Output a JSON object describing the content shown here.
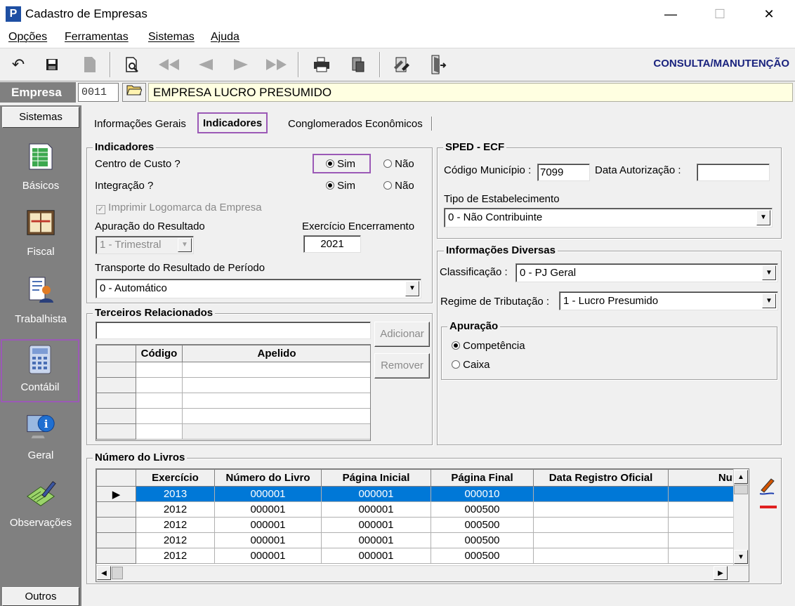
{
  "window": {
    "title": "Cadastro de Empresas",
    "app_icon": "P",
    "minimize": "—",
    "maximize": "☐",
    "close": "✕"
  },
  "menu": {
    "items": [
      "Opções",
      "Ferramentas",
      "Sistemas",
      "Ajuda"
    ]
  },
  "toolbar": {
    "mode_label": "CONSULTA/MANUTENÇÃO"
  },
  "empresa": {
    "label": "Empresa",
    "code": "0011",
    "name": "EMPRESA LUCRO PRESUMIDO"
  },
  "sidebar": {
    "header": "Sistemas",
    "footer": "Outros",
    "items": [
      {
        "label": "Básicos",
        "icon": "spreadsheet-icon"
      },
      {
        "label": "Fiscal",
        "icon": "ledger-book-icon"
      },
      {
        "label": "Trabalhista",
        "icon": "worker-document-icon"
      },
      {
        "label": "Contábil",
        "icon": "calculator-icon"
      },
      {
        "label": "Geral",
        "icon": "info-monitor-icon"
      },
      {
        "label": "Observações",
        "icon": "notes-pencil-icon"
      }
    ]
  },
  "tabs": [
    "Informações Gerais",
    "Indicadores",
    "Conglomerados Econômicos"
  ],
  "indicadores": {
    "title": "Indicadores",
    "centro_custo": {
      "label": "Centro de Custo ?",
      "sim": "Sim",
      "nao": "Não",
      "value": "Sim"
    },
    "integracao": {
      "label": "Integração ?",
      "sim": "Sim",
      "nao": "Não",
      "value": "Sim"
    },
    "logomarca": {
      "label": "Imprimir Logomarca da Empresa",
      "checked": true
    },
    "apuracao_resultado": {
      "label": "Apuração do Resultado",
      "value": "1 - Trimestral"
    },
    "exercicio_encerramento": {
      "label": "Exercício Encerramento",
      "value": "2021"
    },
    "transporte": {
      "label": "Transporte do Resultado de Período",
      "value": "0 - Automático"
    }
  },
  "terceiros": {
    "title": "Terceiros Relacionados",
    "add_label": "Adicionar",
    "remove_label": "Remover",
    "columns": [
      "Código",
      "Apelido"
    ]
  },
  "sped": {
    "title": "SPED - ECF",
    "codigo_municipio": {
      "label": "Código Município :",
      "value": "7099"
    },
    "data_autorizacao": {
      "label": "Data Autorização :",
      "value": ""
    },
    "tipo_estabelecimento": {
      "label": "Tipo de Estabelecimento",
      "value": "0 - Não Contribuinte"
    }
  },
  "diversas": {
    "title": "Informações Diversas",
    "classificacao": {
      "label": "Classificação :",
      "value": "0 - PJ Geral"
    },
    "regime": {
      "label": "Regime de Tributação :",
      "value": "1 - Lucro Presumido"
    },
    "apuracao": {
      "title": "Apuração",
      "competencia": "Competência",
      "caixa": "Caixa",
      "value": "Competência"
    }
  },
  "livros": {
    "title": "Número do Livros",
    "columns": [
      "Exercício",
      "Número do Livro",
      "Página Inicial",
      "Página Final",
      "Data Registro Oficial",
      "Nun"
    ],
    "rows": [
      [
        "2013",
        "000001",
        "000001",
        "000010",
        ""
      ],
      [
        "2012",
        "000001",
        "000001",
        "000500",
        ""
      ],
      [
        "2012",
        "000001",
        "000001",
        "000500",
        ""
      ],
      [
        "2012",
        "000001",
        "000001",
        "000500",
        ""
      ],
      [
        "2012",
        "000001",
        "000001",
        "000500",
        ""
      ]
    ]
  }
}
